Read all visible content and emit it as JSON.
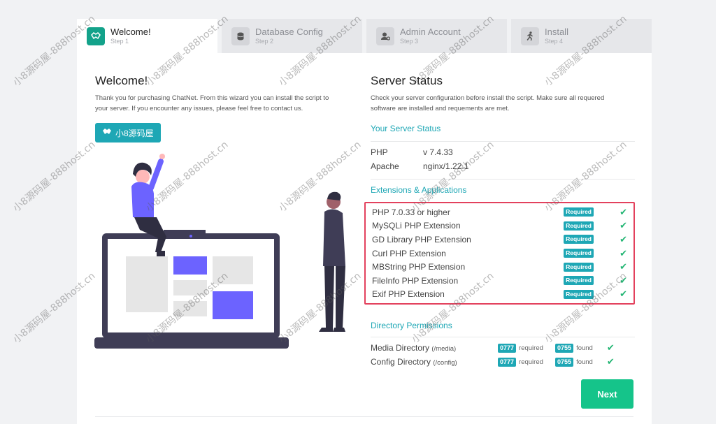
{
  "steps": [
    {
      "title": "Welcome!",
      "sub": "Step 1",
      "icon": "handshake-icon"
    },
    {
      "title": "Database Config",
      "sub": "Step 2",
      "icon": "database-icon"
    },
    {
      "title": "Admin Account",
      "sub": "Step 3",
      "icon": "user-cog-icon"
    },
    {
      "title": "Install",
      "sub": "Step 4",
      "icon": "running-icon"
    }
  ],
  "welcome": {
    "title": "Welcome!",
    "desc_line1": "Thank you for purchasing ChatNet. From this wizard you can install the script to",
    "desc_line2": "your server. If you encounter any issues, please feel free to contact us.",
    "brand_button": "小8源码屋"
  },
  "server": {
    "title": "Server Status",
    "desc_line1": "Check your server configuration before install the script. Make sure all requered",
    "desc_line2": "software are installed and requements are met.",
    "status_heading": "Your Server Status",
    "status": [
      {
        "k": "PHP",
        "v": "v 7.4.33"
      },
      {
        "k": "Apache",
        "v": "nginx/1.22.1"
      }
    ],
    "ext_heading": "Extensions & Applications",
    "required_label": "Required",
    "extensions": [
      "PHP 7.0.33 or higher",
      "MySQLi PHP Extension",
      "GD Library PHP Extension",
      "Curl PHP Extension",
      "MBString PHP Extension",
      "FileInfo PHP Extension",
      "Exif PHP Extension"
    ],
    "perm_heading": "Directory Permissions",
    "permissions": [
      {
        "name": "Media Directory",
        "path": "(/media)",
        "required": "0777",
        "required_label": "required",
        "found": "0755",
        "found_label": "found"
      },
      {
        "name": "Config Directory",
        "path": "(/config)",
        "required": "0777",
        "required_label": "required",
        "found": "0755",
        "found_label": "found"
      }
    ],
    "next_button": "Next"
  },
  "watermark": "小8源码屋-888host.cn",
  "colors": {
    "accent": "#1ea7b5",
    "success": "#15c48a",
    "highlight_border": "#e3415d",
    "active_step": "#13a28a",
    "illustration_purple": "#6c63ff",
    "illustration_dark": "#3f3d56"
  }
}
